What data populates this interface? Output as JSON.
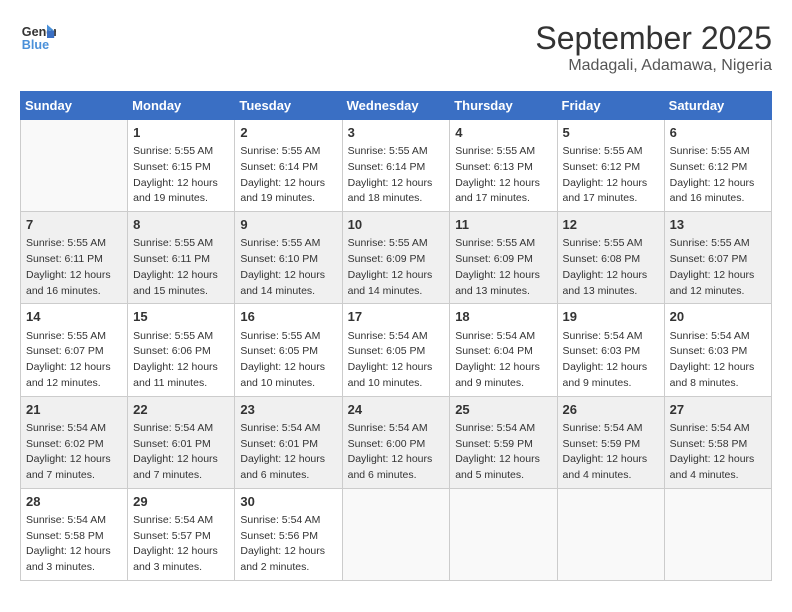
{
  "header": {
    "logo_line1": "General",
    "logo_line2": "Blue",
    "month_title": "September 2025",
    "location": "Madagali, Adamawa, Nigeria"
  },
  "weekdays": [
    "Sunday",
    "Monday",
    "Tuesday",
    "Wednesday",
    "Thursday",
    "Friday",
    "Saturday"
  ],
  "weeks": [
    [
      {
        "day": "",
        "sunrise": "",
        "sunset": "",
        "daylight": ""
      },
      {
        "day": "1",
        "sunrise": "Sunrise: 5:55 AM",
        "sunset": "Sunset: 6:15 PM",
        "daylight": "Daylight: 12 hours and 19 minutes."
      },
      {
        "day": "2",
        "sunrise": "Sunrise: 5:55 AM",
        "sunset": "Sunset: 6:14 PM",
        "daylight": "Daylight: 12 hours and 19 minutes."
      },
      {
        "day": "3",
        "sunrise": "Sunrise: 5:55 AM",
        "sunset": "Sunset: 6:14 PM",
        "daylight": "Daylight: 12 hours and 18 minutes."
      },
      {
        "day": "4",
        "sunrise": "Sunrise: 5:55 AM",
        "sunset": "Sunset: 6:13 PM",
        "daylight": "Daylight: 12 hours and 17 minutes."
      },
      {
        "day": "5",
        "sunrise": "Sunrise: 5:55 AM",
        "sunset": "Sunset: 6:12 PM",
        "daylight": "Daylight: 12 hours and 17 minutes."
      },
      {
        "day": "6",
        "sunrise": "Sunrise: 5:55 AM",
        "sunset": "Sunset: 6:12 PM",
        "daylight": "Daylight: 12 hours and 16 minutes."
      }
    ],
    [
      {
        "day": "7",
        "sunrise": "Sunrise: 5:55 AM",
        "sunset": "Sunset: 6:11 PM",
        "daylight": "Daylight: 12 hours and 16 minutes."
      },
      {
        "day": "8",
        "sunrise": "Sunrise: 5:55 AM",
        "sunset": "Sunset: 6:11 PM",
        "daylight": "Daylight: 12 hours and 15 minutes."
      },
      {
        "day": "9",
        "sunrise": "Sunrise: 5:55 AM",
        "sunset": "Sunset: 6:10 PM",
        "daylight": "Daylight: 12 hours and 14 minutes."
      },
      {
        "day": "10",
        "sunrise": "Sunrise: 5:55 AM",
        "sunset": "Sunset: 6:09 PM",
        "daylight": "Daylight: 12 hours and 14 minutes."
      },
      {
        "day": "11",
        "sunrise": "Sunrise: 5:55 AM",
        "sunset": "Sunset: 6:09 PM",
        "daylight": "Daylight: 12 hours and 13 minutes."
      },
      {
        "day": "12",
        "sunrise": "Sunrise: 5:55 AM",
        "sunset": "Sunset: 6:08 PM",
        "daylight": "Daylight: 12 hours and 13 minutes."
      },
      {
        "day": "13",
        "sunrise": "Sunrise: 5:55 AM",
        "sunset": "Sunset: 6:07 PM",
        "daylight": "Daylight: 12 hours and 12 minutes."
      }
    ],
    [
      {
        "day": "14",
        "sunrise": "Sunrise: 5:55 AM",
        "sunset": "Sunset: 6:07 PM",
        "daylight": "Daylight: 12 hours and 12 minutes."
      },
      {
        "day": "15",
        "sunrise": "Sunrise: 5:55 AM",
        "sunset": "Sunset: 6:06 PM",
        "daylight": "Daylight: 12 hours and 11 minutes."
      },
      {
        "day": "16",
        "sunrise": "Sunrise: 5:55 AM",
        "sunset": "Sunset: 6:05 PM",
        "daylight": "Daylight: 12 hours and 10 minutes."
      },
      {
        "day": "17",
        "sunrise": "Sunrise: 5:54 AM",
        "sunset": "Sunset: 6:05 PM",
        "daylight": "Daylight: 12 hours and 10 minutes."
      },
      {
        "day": "18",
        "sunrise": "Sunrise: 5:54 AM",
        "sunset": "Sunset: 6:04 PM",
        "daylight": "Daylight: 12 hours and 9 minutes."
      },
      {
        "day": "19",
        "sunrise": "Sunrise: 5:54 AM",
        "sunset": "Sunset: 6:03 PM",
        "daylight": "Daylight: 12 hours and 9 minutes."
      },
      {
        "day": "20",
        "sunrise": "Sunrise: 5:54 AM",
        "sunset": "Sunset: 6:03 PM",
        "daylight": "Daylight: 12 hours and 8 minutes."
      }
    ],
    [
      {
        "day": "21",
        "sunrise": "Sunrise: 5:54 AM",
        "sunset": "Sunset: 6:02 PM",
        "daylight": "Daylight: 12 hours and 7 minutes."
      },
      {
        "day": "22",
        "sunrise": "Sunrise: 5:54 AM",
        "sunset": "Sunset: 6:01 PM",
        "daylight": "Daylight: 12 hours and 7 minutes."
      },
      {
        "day": "23",
        "sunrise": "Sunrise: 5:54 AM",
        "sunset": "Sunset: 6:01 PM",
        "daylight": "Daylight: 12 hours and 6 minutes."
      },
      {
        "day": "24",
        "sunrise": "Sunrise: 5:54 AM",
        "sunset": "Sunset: 6:00 PM",
        "daylight": "Daylight: 12 hours and 6 minutes."
      },
      {
        "day": "25",
        "sunrise": "Sunrise: 5:54 AM",
        "sunset": "Sunset: 5:59 PM",
        "daylight": "Daylight: 12 hours and 5 minutes."
      },
      {
        "day": "26",
        "sunrise": "Sunrise: 5:54 AM",
        "sunset": "Sunset: 5:59 PM",
        "daylight": "Daylight: 12 hours and 4 minutes."
      },
      {
        "day": "27",
        "sunrise": "Sunrise: 5:54 AM",
        "sunset": "Sunset: 5:58 PM",
        "daylight": "Daylight: 12 hours and 4 minutes."
      }
    ],
    [
      {
        "day": "28",
        "sunrise": "Sunrise: 5:54 AM",
        "sunset": "Sunset: 5:58 PM",
        "daylight": "Daylight: 12 hours and 3 minutes."
      },
      {
        "day": "29",
        "sunrise": "Sunrise: 5:54 AM",
        "sunset": "Sunset: 5:57 PM",
        "daylight": "Daylight: 12 hours and 3 minutes."
      },
      {
        "day": "30",
        "sunrise": "Sunrise: 5:54 AM",
        "sunset": "Sunset: 5:56 PM",
        "daylight": "Daylight: 12 hours and 2 minutes."
      },
      {
        "day": "",
        "sunrise": "",
        "sunset": "",
        "daylight": ""
      },
      {
        "day": "",
        "sunrise": "",
        "sunset": "",
        "daylight": ""
      },
      {
        "day": "",
        "sunrise": "",
        "sunset": "",
        "daylight": ""
      },
      {
        "day": "",
        "sunrise": "",
        "sunset": "",
        "daylight": ""
      }
    ]
  ]
}
